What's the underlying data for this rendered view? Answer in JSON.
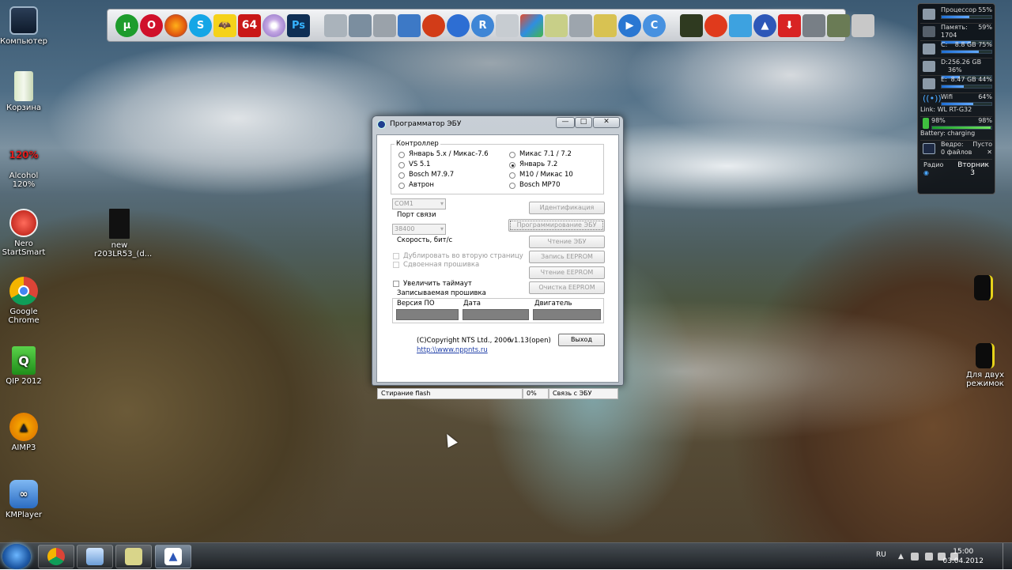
{
  "desktop": {
    "icons": [
      {
        "label": "Компьютер",
        "icon": "computer-icon"
      },
      {
        "label": "Корзина",
        "icon": "recycle-bin-icon"
      },
      {
        "label": "Alcohol 120%",
        "icon": "alcohol-icon"
      },
      {
        "label": "Nero StartSmart",
        "icon": "nero-icon"
      },
      {
        "label": "new r203LR53_(d...",
        "icon": "file-icon"
      },
      {
        "label": "Google Chrome",
        "icon": "chrome-icon"
      },
      {
        "label": "QIP 2012",
        "icon": "qip-icon"
      },
      {
        "label": "AIMP3",
        "icon": "aimp-icon"
      },
      {
        "label": "KMPlayer",
        "icon": "kmplayer-icon"
      },
      {
        "label": "Для двух режимок",
        "icon": "file-icon"
      }
    ],
    "right_file_1": "",
    "right_file_2": "Для двух режимок"
  },
  "quickbar": {
    "badge_64": "64",
    "ps_label": "Ps"
  },
  "gadget": {
    "cpu_label": "Процессор",
    "cpu_value": "55%",
    "cpu_percent": 55,
    "ram_label": "Память: 1704",
    "ram_value": "59%",
    "ram_percent": 59,
    "drive_c_label": "C:",
    "drive_c_size": "8.8 GB",
    "drive_c_value": "75%",
    "drive_c_percent": 75,
    "drive_d_label": "D:",
    "drive_d_size": "256.26 GB",
    "drive_d_value": "36%",
    "drive_d_percent": 36,
    "drive_e_label": "E:",
    "drive_e_size": "8.47 GB",
    "drive_e_value": "44%",
    "drive_e_percent": 44,
    "wifi_label": "Wifi",
    "wifi_value": "64%",
    "wifi_percent": 64,
    "link_label": "Link: WL RT-G32",
    "battery_left": "98%",
    "battery_right": "98%",
    "battery_percent": 98,
    "battery_status": "Battery: charging",
    "bucket_label": "Ведро:",
    "bucket_value": "Пусто",
    "bucket_files": "0 файлов",
    "radio_label": "Радио",
    "day_label": "Вторник",
    "day_number": "3"
  },
  "window": {
    "title": "Программатор ЭБУ",
    "minimize_label": "—",
    "maximize_label": "□",
    "close_label": "✕",
    "controller_group": "Контроллер",
    "controllers_left": [
      {
        "label": "Январь 5.x / Микас-7.6",
        "selected": false
      },
      {
        "label": "VS 5.1",
        "selected": false
      },
      {
        "label": "Bosch M7.9.7",
        "selected": false
      },
      {
        "label": "Автрон",
        "selected": false
      }
    ],
    "controllers_right": [
      {
        "label": "Микас 7.1 / 7.2",
        "selected": false
      },
      {
        "label": "Январь 7.2",
        "selected": true
      },
      {
        "label": "M10 / Микас 10",
        "selected": false
      },
      {
        "label": "Bosch MP70",
        "selected": false
      }
    ],
    "port_value": "COM1",
    "port_label": "Порт связи",
    "speed_value": "38400",
    "speed_label": "Скорость, бит/с",
    "btn_identify": "Идентификация",
    "btn_program": "Программирование ЭБУ",
    "btn_read_ecu": "Чтение ЭБУ",
    "btn_write_eeprom": "Запись EEPROM",
    "btn_read_eeprom": "Чтение EEPROM",
    "btn_clear_eeprom": "Очистка EEPROM",
    "chk_duplicate": "Дублировать во вторую страницу",
    "chk_double": "Сдвоенная прошивка",
    "chk_timeout": "Увеличить таймаут",
    "firmware_label": "Записываемая прошивка",
    "col_version": "Версия ПО",
    "col_date": "Дата",
    "col_engine": "Двигатель",
    "copyright": "(C)Copyright NTS Ltd., 2006",
    "version": "v1.13(open)",
    "url": "http:\\\\www.nppnts.ru",
    "btn_exit": "Выход",
    "status_text": "Стирание flash",
    "status_percent": "0%",
    "status_link": "Связь с ЭБУ"
  },
  "taskbar": {
    "lang": "RU",
    "time": "15:00",
    "date": "03.04.2012"
  }
}
